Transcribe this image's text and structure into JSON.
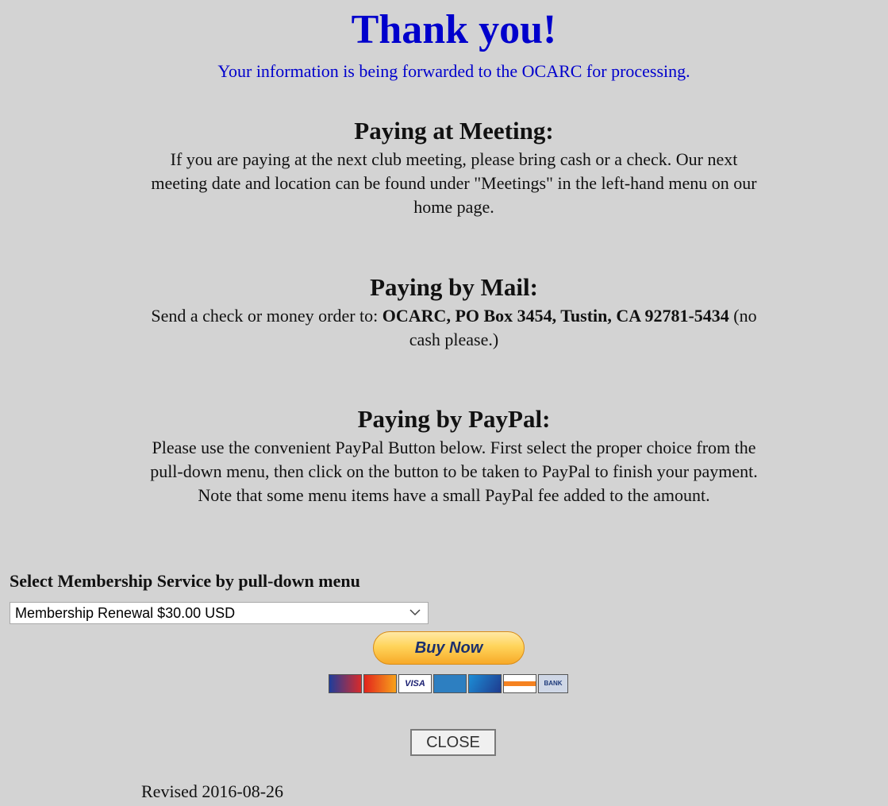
{
  "header": {
    "title": "Thank you!",
    "subtitle": "Your information is being forwarded to the OCARC for processing."
  },
  "sections": {
    "meeting": {
      "heading": "Paying at Meeting:",
      "body": "If you are paying at the next club meeting, please bring cash or a check. Our next meeting date and location can be found under \"Meetings\" in the left-hand menu on our home page."
    },
    "mail": {
      "heading": "Paying by Mail:",
      "body_prefix": "Send a check or money order to: ",
      "body_address": "OCARC, PO Box 3454, Tustin, CA 92781-5434",
      "body_suffix": " (no cash please.)"
    },
    "paypal": {
      "heading": "Paying by PayPal:",
      "body": "Please use the convenient PayPal Button below. First select the proper choice from the pull-down menu, then click on the button to be taken to PayPal to finish your payment. Note that some menu items have a small PayPal fee added to the amount."
    }
  },
  "form": {
    "select_label": "Select Membership Service by pull-down menu",
    "selected_option": "Membership Renewal $30.00 USD",
    "buy_now_label": "Buy Now",
    "payment_cards": [
      "maestro",
      "mastercard",
      "visa",
      "amex",
      "discover-net",
      "discover",
      "bank"
    ],
    "card_labels": {
      "visa": "VISA",
      "bank": "BANK"
    }
  },
  "footer": {
    "close_label": "CLOSE",
    "revised": "Revised 2016-08-26"
  },
  "colors": {
    "background": "#d3d3d3",
    "title_blue": "#0000cc",
    "paypal_gold": "#ffd45a"
  }
}
